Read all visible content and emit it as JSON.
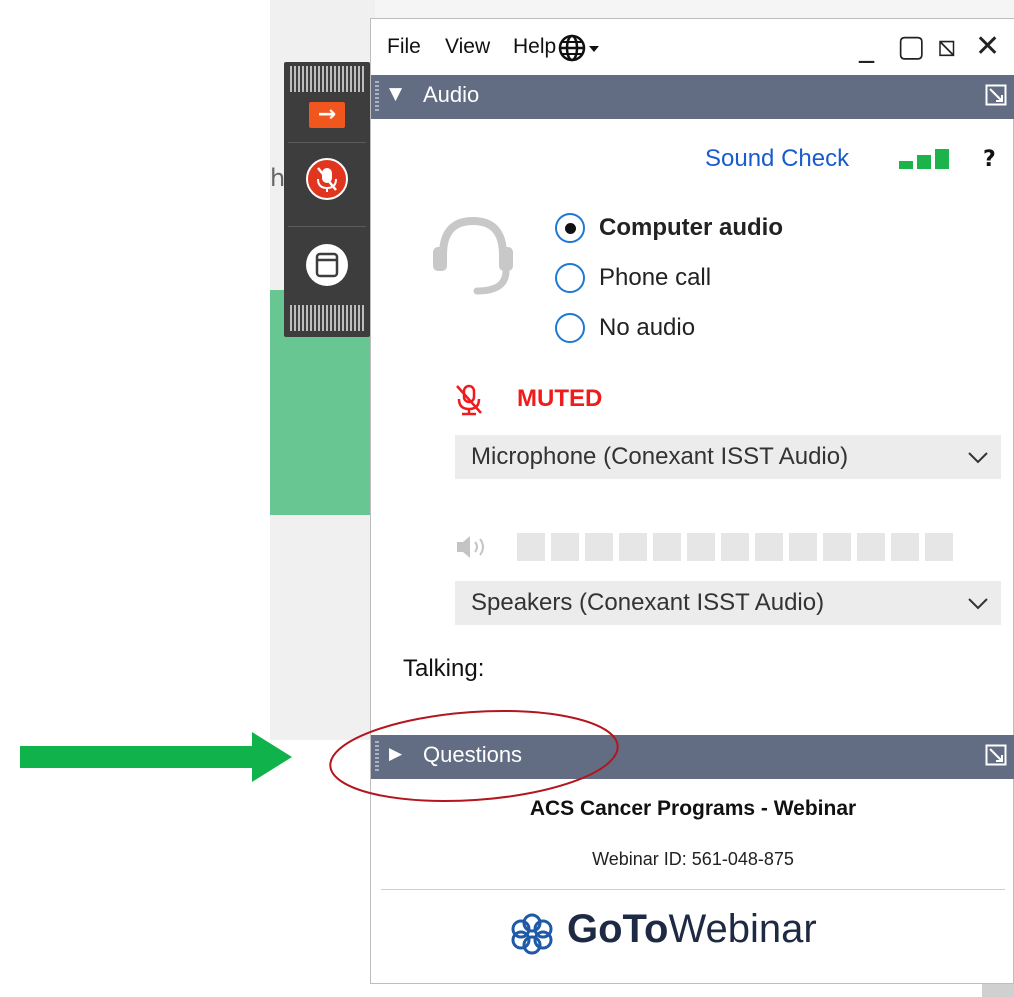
{
  "background_app": {
    "text_fragment": "h"
  },
  "control_panel": {
    "grabber_icon": "grabber-icon",
    "show_panel_icon": "arrow-right-icon",
    "mic_icon": "mic-muted-icon",
    "screen_icon": "window-icon",
    "colors": {
      "panel": "#3d3d3d",
      "arrow": "#f0561d",
      "mic": "#e0361f"
    }
  },
  "window": {
    "menu": {
      "file": "File",
      "view": "View",
      "help": "Help",
      "language_icon": "globe-icon"
    },
    "controls": {
      "minimize": "_",
      "maximize": "▢",
      "popout": "⧅",
      "close": "✕"
    }
  },
  "audio_panel": {
    "title": "Audio",
    "sound_check": "Sound Check",
    "help": "?",
    "options": [
      {
        "label": "Computer audio",
        "selected": true
      },
      {
        "label": "Phone call",
        "selected": false
      },
      {
        "label": "No audio",
        "selected": false
      }
    ],
    "mute_status": "MUTED",
    "microphone": "Microphone (Conexant ISST Audio)",
    "speakers": "Speakers (Conexant ISST Audio)",
    "talking_label": "Talking:",
    "speaker_level_cells": 13,
    "speaker_level": 0
  },
  "questions_panel": {
    "title": "Questions"
  },
  "footer": {
    "webinar_title": "ACS Cancer Programs - Webinar",
    "webinar_id": "Webinar ID: 561-048-875",
    "logo": {
      "bold": "GoTo",
      "regular": "Webinar"
    }
  },
  "colors": {
    "section_bar": "#626d83",
    "link_blue": "#1a5ccc",
    "muted_red": "#ee1c1c",
    "level_green": "#1db34b",
    "annotation_arrow": "#10b24c",
    "annotation_ellipse": "#b3161c"
  }
}
